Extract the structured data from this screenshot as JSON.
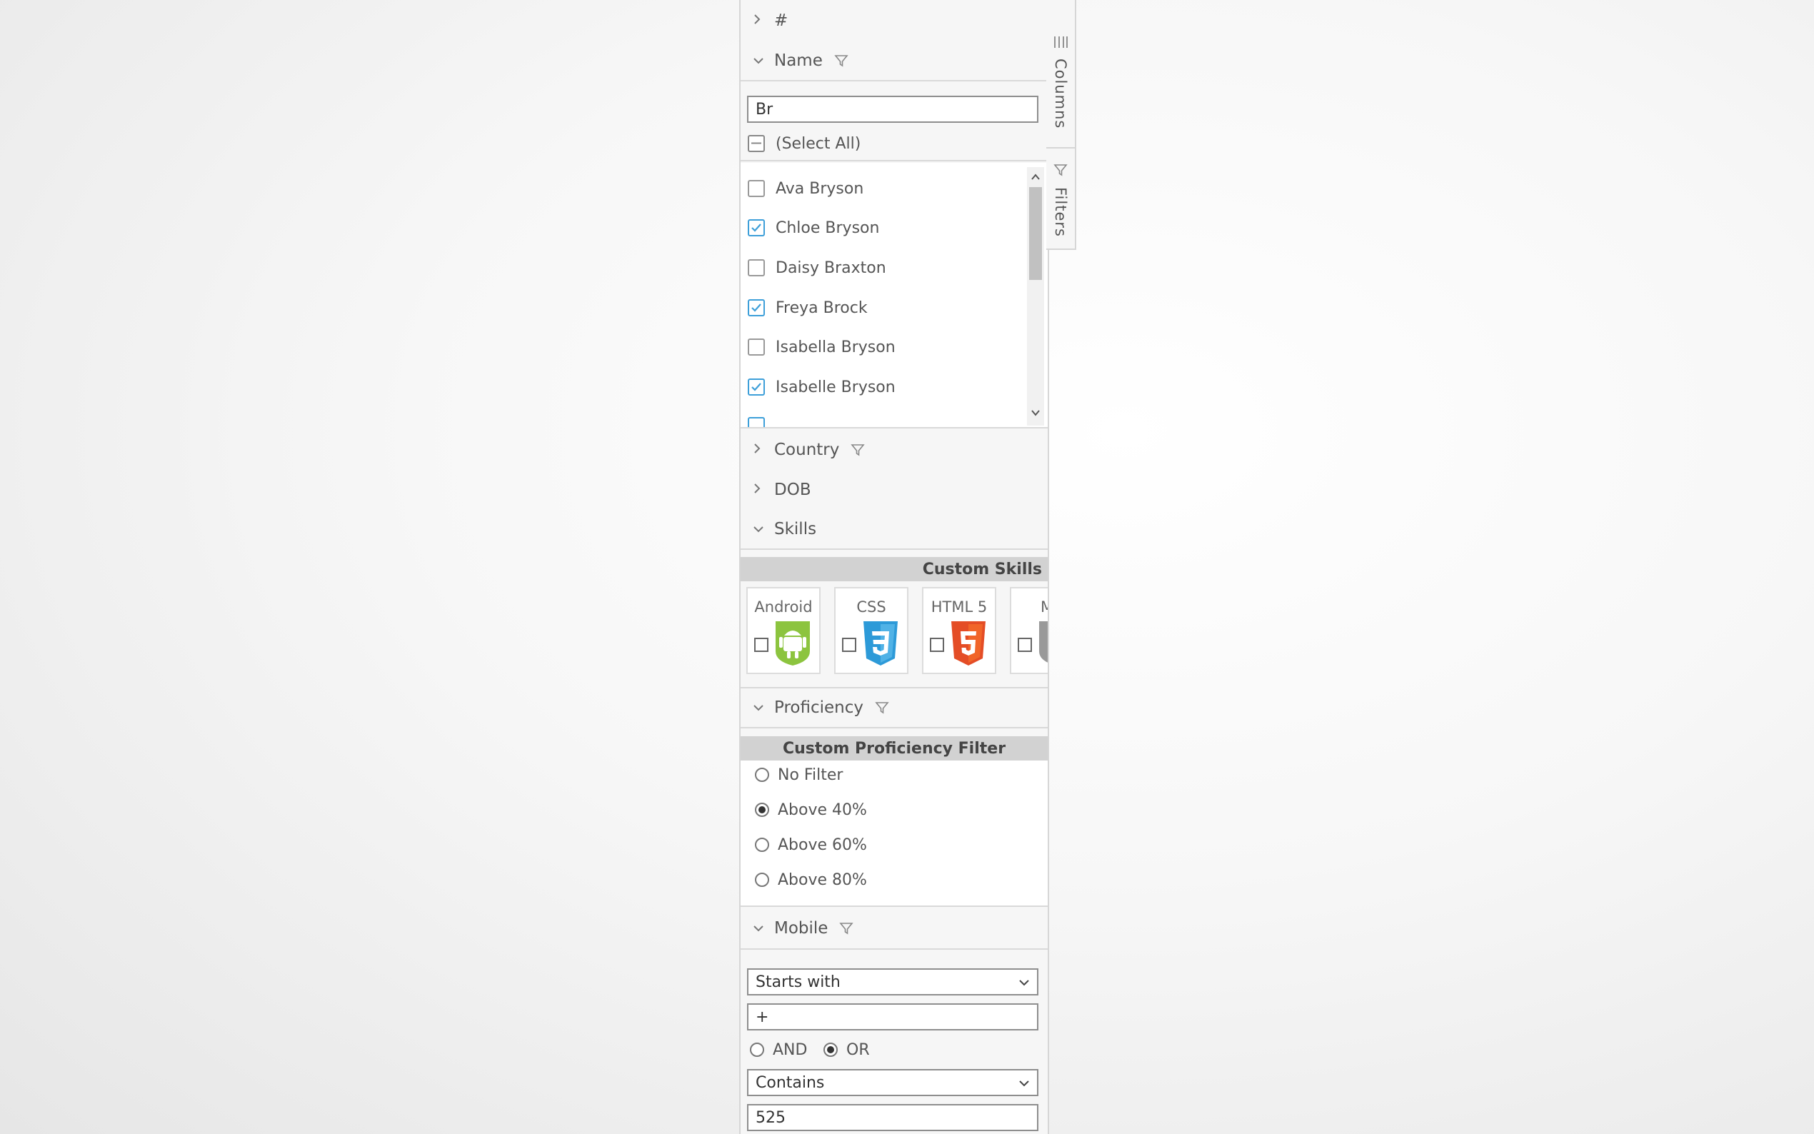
{
  "side_tabs": {
    "columns": "Columns",
    "filters": "Filters"
  },
  "groups": {
    "hash": "#",
    "name": "Name",
    "country": "Country",
    "dob": "DOB",
    "skills": "Skills",
    "proficiency": "Proficiency",
    "mobile": "Mobile"
  },
  "name_filter": {
    "search_value": "Br",
    "select_all": "(Select All)",
    "items": [
      {
        "label": "Ava Bryson",
        "checked": false
      },
      {
        "label": "Chloe Bryson",
        "checked": true
      },
      {
        "label": "Daisy Braxton",
        "checked": false
      },
      {
        "label": "Freya Brock",
        "checked": true
      },
      {
        "label": "Isabella Bryson",
        "checked": false
      },
      {
        "label": "Isabelle Bryson",
        "checked": true
      }
    ]
  },
  "skills_filter": {
    "title": "Custom Skills",
    "skills": [
      {
        "label": "Android",
        "icon": "android-icon",
        "color": "#8cc43f"
      },
      {
        "label": "CSS",
        "icon": "css3-icon",
        "color": "#2d9ad8"
      },
      {
        "label": "HTML 5",
        "icon": "html5-icon",
        "color": "#e44d26"
      },
      {
        "label": "M",
        "icon": "mac-icon",
        "color": "#999999"
      }
    ]
  },
  "proficiency_filter": {
    "title": "Custom Proficiency Filter",
    "options": [
      "No Filter",
      "Above 40%",
      "Above 60%",
      "Above 80%"
    ],
    "selected": "Above 40%"
  },
  "mobile_filter": {
    "condition1_type": "Starts with",
    "condition1_value": "+",
    "join_and": "AND",
    "join_or": "OR",
    "join_selected": "OR",
    "condition2_type": "Contains",
    "condition2_value": "525"
  },
  "colors": {
    "accent": "#3d9fd9",
    "header_bar": "#d2d2d2"
  }
}
